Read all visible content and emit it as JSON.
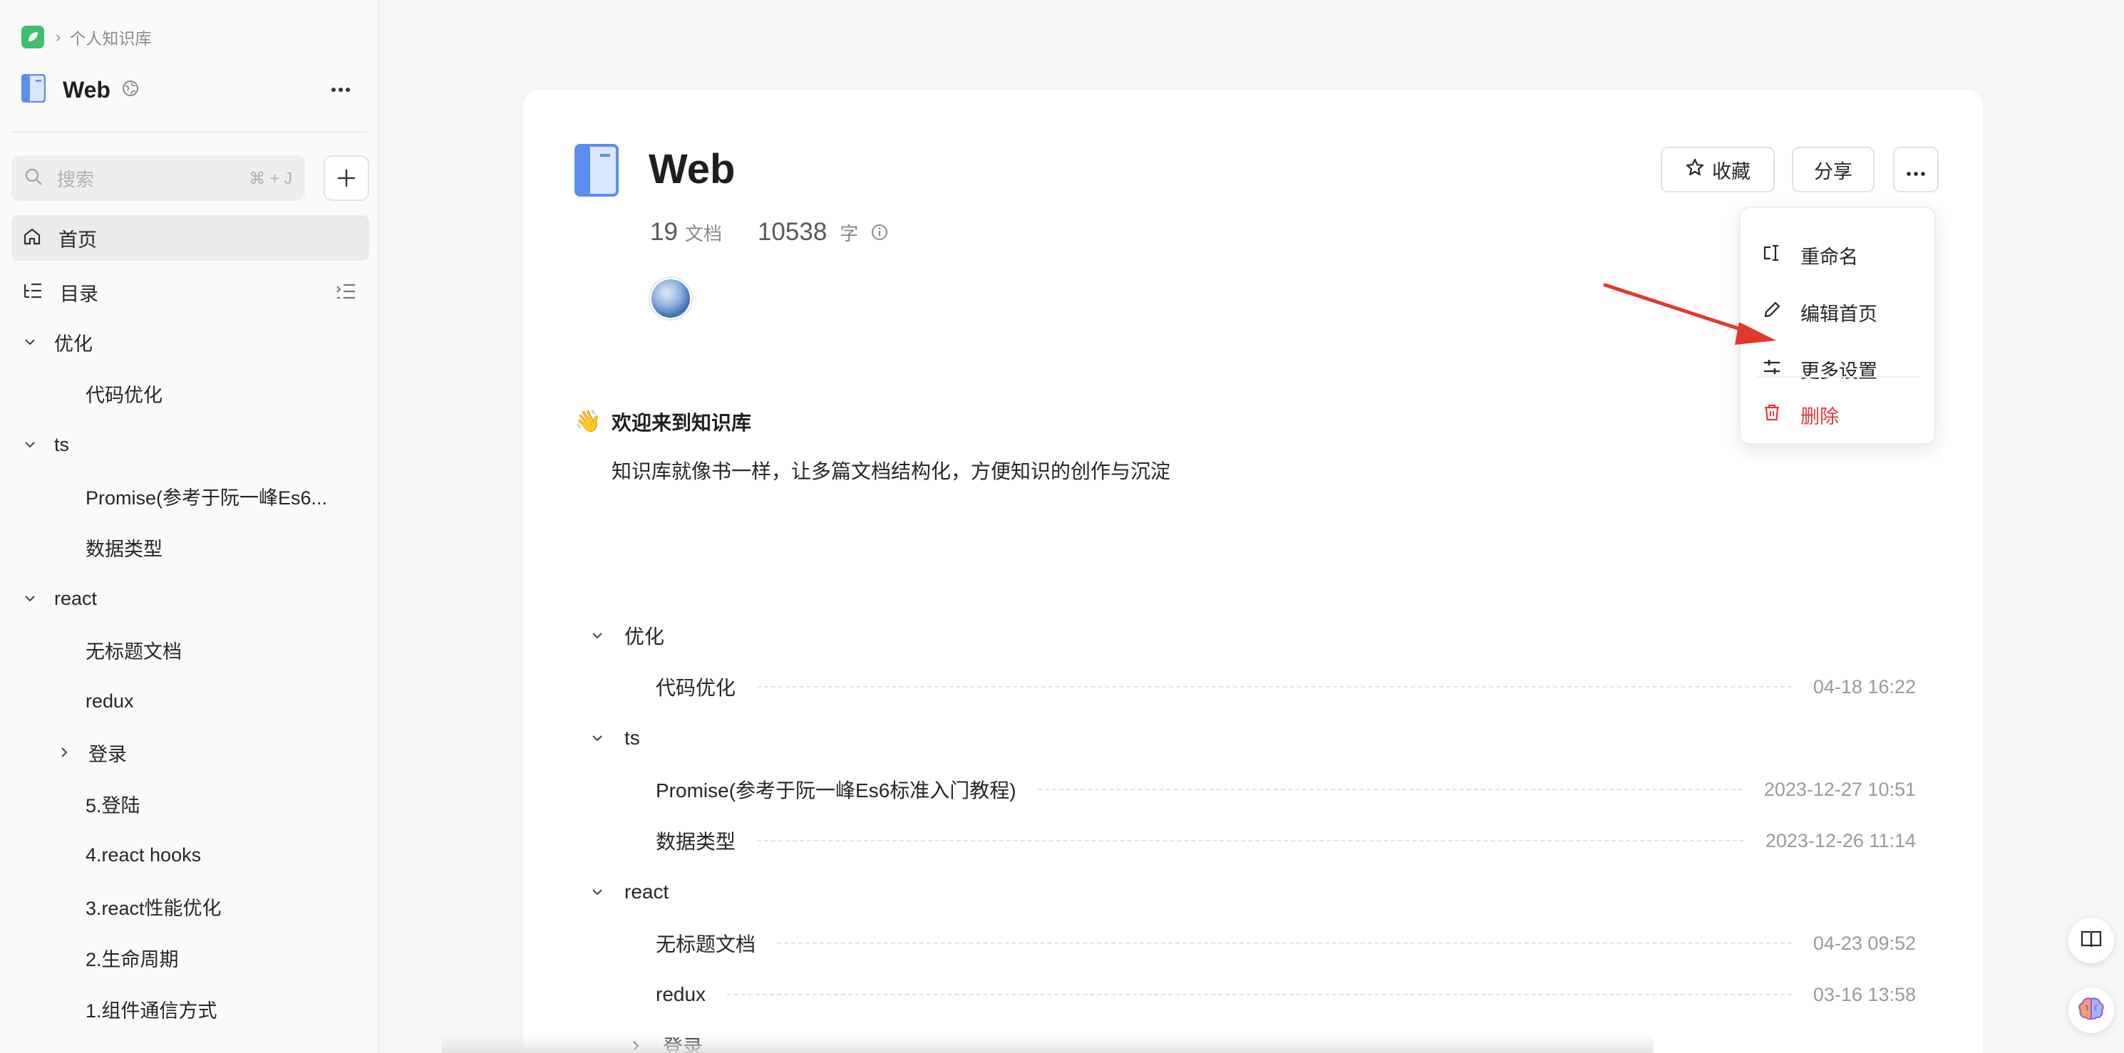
{
  "breadcrumb": {
    "text": "个人知识库"
  },
  "sidebar": {
    "kb_title": "Web",
    "search": {
      "placeholder": "搜索",
      "shortcut": "⌘ + J"
    },
    "nav": [
      {
        "label": "首页",
        "icon": "home-icon"
      },
      {
        "label": "目录",
        "icon": "toc-icon"
      }
    ],
    "tree": [
      {
        "label": "优化",
        "type": "group"
      },
      {
        "label": "代码优化",
        "type": "doc"
      },
      {
        "label": "ts",
        "type": "group"
      },
      {
        "label": "Promise(参考于阮一峰Es6...",
        "type": "doc"
      },
      {
        "label": "数据类型",
        "type": "doc"
      },
      {
        "label": "react",
        "type": "group"
      },
      {
        "label": "无标题文档",
        "type": "doc"
      },
      {
        "label": "redux",
        "type": "doc"
      },
      {
        "label": "登录",
        "type": "folder"
      },
      {
        "label": "5.登陆",
        "type": "doc"
      },
      {
        "label": "4.react hooks",
        "type": "doc"
      },
      {
        "label": "3.react性能优化",
        "type": "doc"
      },
      {
        "label": "2.生命周期",
        "type": "doc"
      },
      {
        "label": "1.组件通信方式",
        "type": "doc"
      }
    ]
  },
  "main": {
    "title": "Web",
    "stats": {
      "docs": "19",
      "docs_unit": "文档",
      "words": "10538",
      "words_unit": "字"
    },
    "buttons": {
      "favorite": "收藏",
      "share": "分享"
    },
    "dropdown": {
      "rename": "重命名",
      "edit_home": "编辑首页",
      "more_settings": "更多设置",
      "delete": "删除"
    },
    "welcome": {
      "emoji": "👋",
      "title": "欢迎来到知识库",
      "desc": "知识库就像书一样，让多篇文档结构化，方便知识的创作与沉淀"
    },
    "toc": {
      "groups": [
        "优化",
        "ts",
        "react"
      ],
      "rows": [
        {
          "title": "代码优化",
          "time": "04-18 16:22"
        },
        {
          "title": "Promise(参考于阮一峰Es6标准入门教程)",
          "time": "2023-12-27 10:51"
        },
        {
          "title": "数据类型",
          "time": "2023-12-26 11:14"
        },
        {
          "title": "无标题文档",
          "time": "04-23 09:52"
        },
        {
          "title": "redux",
          "time": "03-16 13:58"
        }
      ],
      "folder": "登录"
    }
  },
  "colors": {
    "accent_red": "#e0393e",
    "logo_green": "#3fbf6a",
    "book_blue": "#5b8def"
  }
}
